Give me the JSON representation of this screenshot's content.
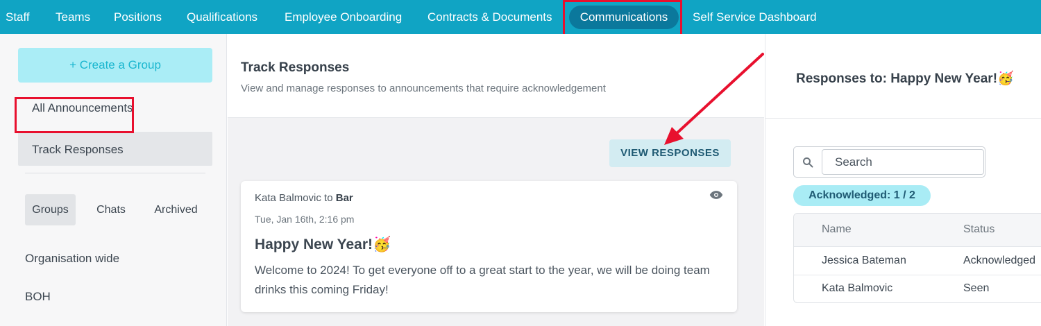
{
  "nav": {
    "items": [
      "Staff",
      "Teams",
      "Positions",
      "Qualifications",
      "Employee Onboarding",
      "Contracts & Documents",
      "Communications",
      "Self Service Dashboard"
    ],
    "active": "Communications"
  },
  "sidebar": {
    "create_label": "+ Create a Group",
    "all_announcements": "All Announcements",
    "track_responses": "Track Responses",
    "tabs": [
      "Groups",
      "Chats",
      "Archived"
    ],
    "groups": [
      "Organisation wide",
      "BOH"
    ]
  },
  "main": {
    "title": "Track Responses",
    "subtitle": "View and manage responses to announcements that require acknowledgement",
    "view_button": "VIEW RESPONSES",
    "card": {
      "from": "Kata Balmovic",
      "to_word": "to",
      "to": "Bar",
      "date": "Tue, Jan 16th, 2:16 pm",
      "title": "Happy New Year!🥳",
      "body": "Welcome to 2024! To get everyone off to a great start to the year, we will be doing team drinks this coming Friday!"
    }
  },
  "responses": {
    "title": "Responses to: Happy New Year!🥳",
    "search_placeholder": "Search",
    "acknowledged": "Acknowledged: 1 / 2",
    "columns": [
      "Name",
      "Status"
    ],
    "rows": [
      {
        "name": "Jessica Bateman",
        "status": "Acknowledged"
      },
      {
        "name": "Kata Balmovic",
        "status": "Seen"
      }
    ]
  },
  "colors": {
    "nav_bg": "#10a4c4",
    "highlight": "#e8102e",
    "accent": "#1ab6cf"
  }
}
